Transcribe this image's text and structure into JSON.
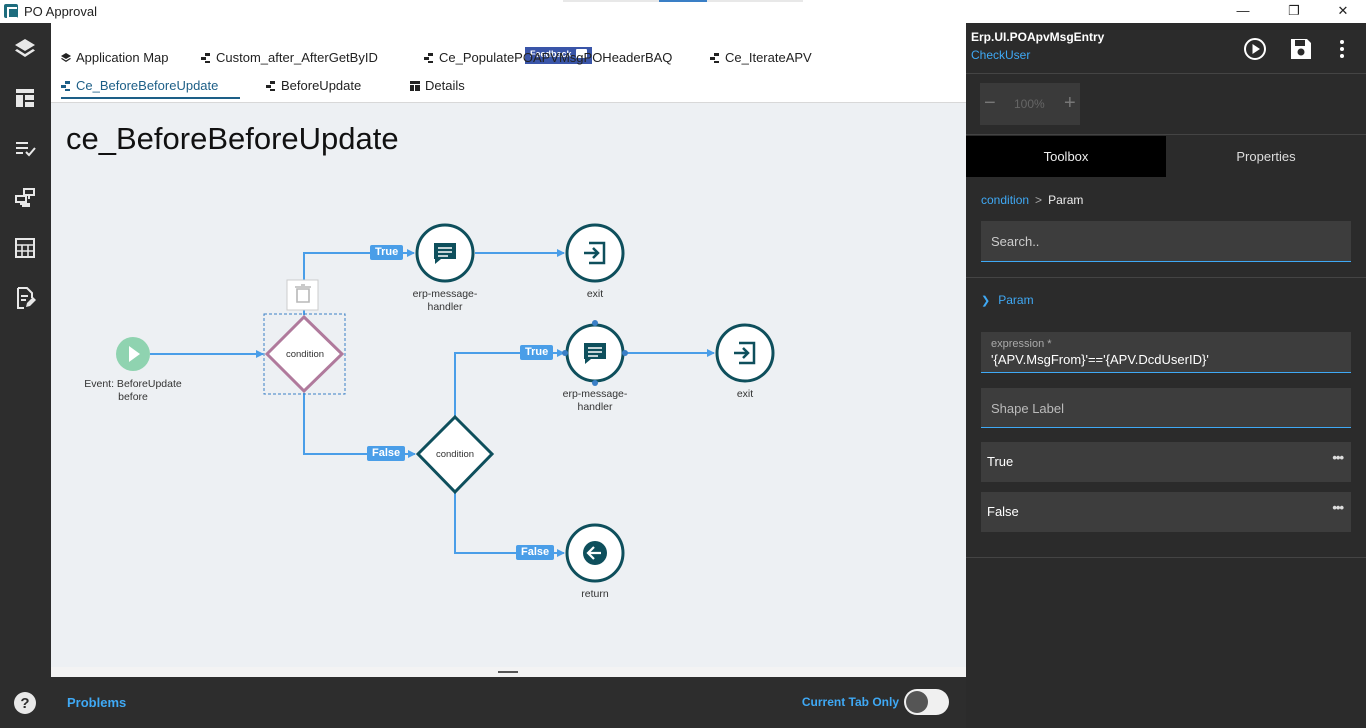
{
  "window": {
    "title": "PO Approval",
    "minimize": "—",
    "maximize": "❐",
    "close": "✕"
  },
  "leftnav": {
    "icons": [
      "layers-icon",
      "layout-icon",
      "checklist-icon",
      "flow-icon",
      "grid-icon",
      "edit-doc-icon",
      "help-icon"
    ],
    "help_label": "?"
  },
  "feedback": {
    "label": "Feedback"
  },
  "tabs": [
    {
      "label": "Application Map",
      "active": false
    },
    {
      "label": "Custom_after_AfterGetByID",
      "active": false
    },
    {
      "label": "Ce_PopulatePOAPVMsgPOHeaderBAQ",
      "active": false
    },
    {
      "label": "Ce_IterateAPV",
      "active": false
    },
    {
      "label": "Ce_BeforeBeforeUpdate",
      "active": true
    },
    {
      "label": "BeforeUpdate",
      "active": false
    },
    {
      "label": "Details",
      "active": false
    }
  ],
  "canvas": {
    "title": "ce_BeforeBeforeUpdate",
    "nodes": {
      "event_label": "Event: BeforeUpdate before",
      "condition1": "condition",
      "condition2": "condition",
      "msg1": "erp-message-handler",
      "msg2": "erp-message-handler",
      "exit1": "exit",
      "exit2": "exit",
      "return": "return"
    },
    "edges": {
      "true1": "True",
      "true2": "True",
      "false1": "False",
      "false2": "False"
    }
  },
  "problems": {
    "label": "Problems",
    "current_tab_label": "Current Tab Only",
    "current_tab_on": false
  },
  "rightpanel": {
    "title": "Erp.UI.POApvMsgEntry",
    "subtitle": "CheckUser",
    "zoom": {
      "minus": "−",
      "value": "100%",
      "plus": "+"
    },
    "tabs": [
      {
        "label": "Toolbox",
        "active": true
      },
      {
        "label": "Properties",
        "active": false
      }
    ],
    "breadcrumb": {
      "parent": "condition",
      "separator": ">",
      "current": "Param"
    },
    "search_placeholder": "Search..",
    "section_label": "Param",
    "expression_label": "expression *",
    "expression_value": "'{APV.MsgFrom}'=='{APV.DcdUserID}'",
    "shape_label_placeholder": "Shape Label",
    "branches": [
      {
        "label": "True",
        "more": "•••"
      },
      {
        "label": "False",
        "more": "•••"
      }
    ]
  },
  "colors": {
    "accent": "#3fa9f5",
    "edge": "#4a9ee8",
    "node_teal": "#0e4f5c",
    "selected_condition": "#b07a9c",
    "event_green": "#8fd3b0",
    "nav_dark": "#2d2d2d"
  }
}
